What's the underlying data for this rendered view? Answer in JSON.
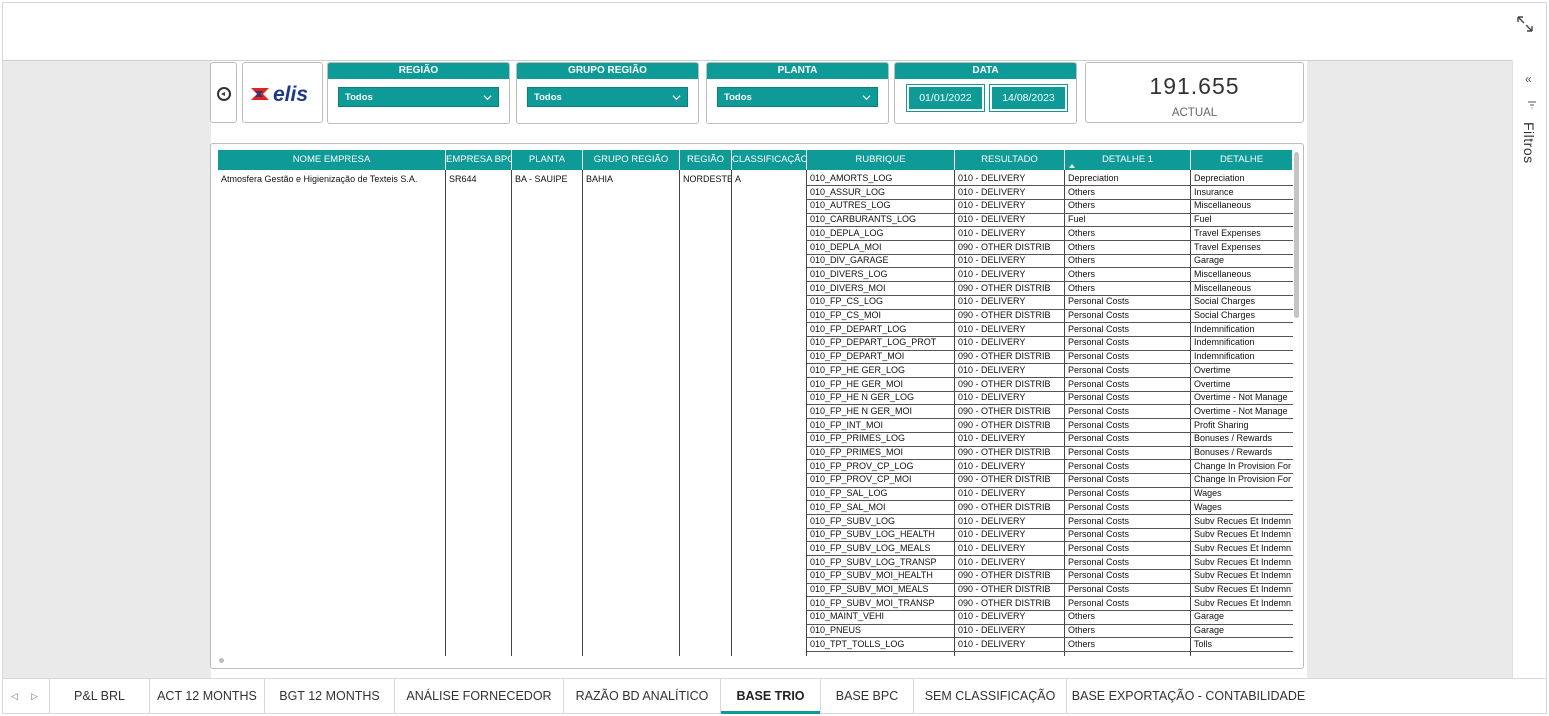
{
  "kpi": {
    "value": "191.655",
    "label": "ACTUAL"
  },
  "slicers": {
    "regiao": {
      "title": "REGIÃO",
      "value": "Todos"
    },
    "grupo_regiao": {
      "title": "GRUPO REGIÃO",
      "value": "Todos"
    },
    "planta": {
      "title": "PLANTA",
      "value": "Todos"
    },
    "data": {
      "title": "DATA",
      "start": "01/01/2022",
      "end": "14/08/2023"
    }
  },
  "logo_text": "elis",
  "filter_pane_label": "Filtros",
  "table": {
    "headers": [
      "NOME EMPRESA",
      "EMPRESA BPC",
      "PLANTA",
      "GRUPO REGIÃO",
      "REGIÃO",
      "CLASSIFICAÇÃO",
      "RUBRIQUE",
      "RESULTADO",
      "DETALHE 1",
      "DETALHE"
    ],
    "group": {
      "nome_empresa": "Atmosfera Gestão e Higienização de Texteis S.A.",
      "empresa_bpc": "SR644",
      "planta": "BA - SAUIPE",
      "grupo_regiao": "BAHIA",
      "regiao": "NORDESTE",
      "classificacao": "A"
    },
    "rows": [
      [
        "010_AMORTS_LOG",
        "010 - DELIVERY",
        "Depreciation",
        "Depreciation"
      ],
      [
        "010_ASSUR_LOG",
        "010 - DELIVERY",
        "Others",
        "Insurance"
      ],
      [
        "010_AUTRES_LOG",
        "010 - DELIVERY",
        "Others",
        "Miscellaneous"
      ],
      [
        "010_CARBURANTS_LOG",
        "010 - DELIVERY",
        "Fuel",
        "Fuel"
      ],
      [
        "010_DEPLA_LOG",
        "010 - DELIVERY",
        "Others",
        "Travel Expenses"
      ],
      [
        "010_DEPLA_MOI",
        "090 - OTHER DISTRIB",
        "Others",
        "Travel Expenses"
      ],
      [
        "010_DIV_GARAGE",
        "010 - DELIVERY",
        "Others",
        "Garage"
      ],
      [
        "010_DIVERS_LOG",
        "010 - DELIVERY",
        "Others",
        "Miscellaneous"
      ],
      [
        "010_DIVERS_MOI",
        "090 - OTHER DISTRIB",
        "Others",
        "Miscellaneous"
      ],
      [
        "010_FP_CS_LOG",
        "010 - DELIVERY",
        "Personal Costs",
        "Social Charges"
      ],
      [
        "010_FP_CS_MOI",
        "090 - OTHER DISTRIB",
        "Personal Costs",
        "Social Charges"
      ],
      [
        "010_FP_DEPART_LOG",
        "010 - DELIVERY",
        "Personal Costs",
        "Indemnification"
      ],
      [
        "010_FP_DEPART_LOG_PROT",
        "010 - DELIVERY",
        "Personal Costs",
        "Indemnification"
      ],
      [
        "010_FP_DEPART_MOI",
        "090 - OTHER DISTRIB",
        "Personal Costs",
        "Indemnification"
      ],
      [
        "010_FP_HE GER_LOG",
        "010 - DELIVERY",
        "Personal Costs",
        "Overtime"
      ],
      [
        "010_FP_HE GER_MOI",
        "090 - OTHER DISTRIB",
        "Personal Costs",
        "Overtime"
      ],
      [
        "010_FP_HE N GER_LOG",
        "010 - DELIVERY",
        "Personal Costs",
        "Overtime - Not Manage"
      ],
      [
        "010_FP_HE N GER_MOI",
        "090 - OTHER DISTRIB",
        "Personal Costs",
        "Overtime - Not Manage"
      ],
      [
        "010_FP_INT_MOI",
        "090 - OTHER DISTRIB",
        "Personal Costs",
        "Profit Sharing"
      ],
      [
        "010_FP_PRIMES_LOG",
        "010 - DELIVERY",
        "Personal Costs",
        "Bonuses / Rewards"
      ],
      [
        "010_FP_PRIMES_MOI",
        "090 - OTHER DISTRIB",
        "Personal Costs",
        "Bonuses / Rewards"
      ],
      [
        "010_FP_PROV_CP_LOG",
        "010 - DELIVERY",
        "Personal Costs",
        "Change In Provision For"
      ],
      [
        "010_FP_PROV_CP_MOI",
        "090 - OTHER DISTRIB",
        "Personal Costs",
        "Change In Provision For"
      ],
      [
        "010_FP_SAL_LOG",
        "010 - DELIVERY",
        "Personal Costs",
        "Wages"
      ],
      [
        "010_FP_SAL_MOI",
        "090 - OTHER DISTRIB",
        "Personal Costs",
        "Wages"
      ],
      [
        "010_FP_SUBV_LOG",
        "010 - DELIVERY",
        "Personal Costs",
        "Subv Recues Et Indemn"
      ],
      [
        "010_FP_SUBV_LOG_HEALTH",
        "010 - DELIVERY",
        "Personal Costs",
        "Subv Recues Et Indemn"
      ],
      [
        "010_FP_SUBV_LOG_MEALS",
        "010 - DELIVERY",
        "Personal Costs",
        "Subv Recues Et Indemn"
      ],
      [
        "010_FP_SUBV_LOG_TRANSP",
        "010 - DELIVERY",
        "Personal Costs",
        "Subv Recues Et Indemn"
      ],
      [
        "010_FP_SUBV_MOI_HEALTH",
        "090 - OTHER DISTRIB",
        "Personal Costs",
        "Subv Recues Et Indemn"
      ],
      [
        "010_FP_SUBV_MOI_MEALS",
        "090 - OTHER DISTRIB",
        "Personal Costs",
        "Subv Recues Et Indemn"
      ],
      [
        "010_FP_SUBV_MOI_TRANSP",
        "090 - OTHER DISTRIB",
        "Personal Costs",
        "Subv Recues Et Indemn"
      ],
      [
        "010_MAINT_VEHI",
        "010 - DELIVERY",
        "Others",
        "Garage"
      ],
      [
        "010_PNEUS",
        "010 - DELIVERY",
        "Others",
        "Garage"
      ],
      [
        "010_TPT_TOLLS_LOG",
        "010 - DELIVERY",
        "Others",
        "Tolls"
      ]
    ]
  },
  "tabs": [
    "P&L BRL",
    "ACT 12 MONTHS",
    "BGT 12 MONTHS",
    "ANÁLISE FORNECEDOR",
    "RAZÃO BD ANALÍTICO",
    "BASE TRIO",
    "BASE BPC",
    "SEM CLASSIFICAÇÃO",
    "BASE EXPORTAÇÃO - CONTABILIDADE"
  ],
  "active_tab": "BASE TRIO",
  "colors": {
    "accent": "#0e9b97",
    "logo_red": "#e2231a",
    "logo_blue": "#1f3a8a"
  },
  "icons": [
    "expand-icon",
    "back-arrow-icon",
    "chevron-down-icon",
    "collapse-pane-icon",
    "filter-icon",
    "sort-caret-icon",
    "tab-prev-icon",
    "tab-next-icon"
  ]
}
